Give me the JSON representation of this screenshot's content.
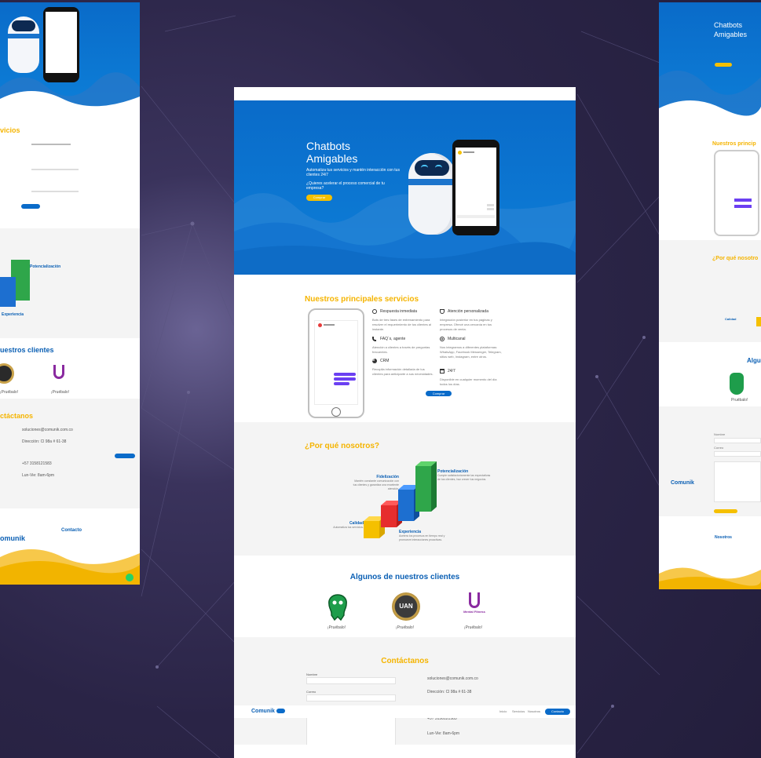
{
  "hero": {
    "title_line1": "Chatbots",
    "title_line2": "Amigables",
    "subtitle": "Automatiza tus servicios y mantén interacción con tus clientes 24/7",
    "question": "¿Quieres acelerar el proceso comercial de tu empresa?",
    "cta": "Comprar"
  },
  "services": {
    "title": "Nuestros principales servicios",
    "items": [
      {
        "title": "Respuesta inmediata",
        "desc": "Bots de tres fases de entrenamiento para resolver el requerimiento de tus clientes al instante."
      },
      {
        "title": "Atención personalizada",
        "desc": "Integración posterior en tus páginas y empresa. Ofrecé una cercanía en tus procesos de venta."
      },
      {
        "title": "FAQ´s, agente",
        "desc": "Atención a clientes a través de preguntas frecuentes."
      },
      {
        "title": "Multicanal",
        "desc": "Nos integramos a diferentes plataformas: WhatsApp, Facebook Messenger, Telegram, sitios web, Instagram, entre otros."
      },
      {
        "title": "CRM",
        "desc": "Recopila información detallada de tus clientes para anticiparte a sus necesidades."
      },
      {
        "title": "24/7",
        "desc": "Disponible en cualquier momento del día todos los días."
      }
    ],
    "cta": "Comprar"
  },
  "why": {
    "title": "¿Por qué nosotros?",
    "labels": [
      {
        "title": "Potencialización",
        "desc": "Cumple satisfactoriamente las expectativas de tus clientes, haz crecer tus negocios."
      },
      {
        "title": "Fidelización",
        "desc": "Mantén constante comunicación con tus clientes y garantiza una excelente atención."
      },
      {
        "title": "Calidad",
        "desc": "Automatiza tus servicios."
      },
      {
        "title": "Experiencia",
        "desc": "Acelera los procesos en tiempo real y promueve interacciones proactivas."
      }
    ]
  },
  "clients": {
    "title": "Algunos de nuestros clientes",
    "items": [
      {
        "label": "¡Pruébalo!"
      },
      {
        "label": "¡Pruébalo!",
        "logo_text": "UAN"
      },
      {
        "label": "¡Pruébalo!",
        "logo_text": "Mental Fitness"
      }
    ]
  },
  "contact": {
    "title": "Contáctanos",
    "name_label": "Nombre",
    "email_label": "Correo",
    "email": "soluciones@comunik.com.co",
    "address": "Dirección: Cl 98a # 61-38",
    "phone": "+57 3158121583",
    "hours": "Lun-Vie: 8am-6pm"
  },
  "navbar": {
    "logo": "Comunik",
    "links": [
      "Inicio",
      "Servicios",
      "Nosotros"
    ],
    "cta": "Contacto"
  },
  "left_mock": {
    "services_title": "vicios",
    "clients_title": "uestros clientes",
    "client_label_1": "¡Pruébalo!",
    "client_label_2": "¡Pruébalo!",
    "contact_title": "ctáctanos",
    "email": "soluciones@comunik.com.co",
    "address": "Dirección: Cl 98a # 61-38",
    "phone": "+57 3158121583",
    "hours": "Lun-Vie: 8am-6pm",
    "footer_title": "Contacto",
    "logo": "omunik",
    "why_label1": "Potencialización",
    "why_label2": "Experiencia"
  },
  "right_mock": {
    "title_line1": "Chatbots",
    "title_line2": "Amigables",
    "services_title": "Nuestros princip",
    "why_title": "¿Por qué nosotro",
    "clients_title": "Algu",
    "client_label": "Pruébalo!",
    "logo": "Comunik",
    "footer_title": "Nosotros",
    "name_label": "Nombre",
    "email_label": "Correo",
    "calidad": "Calidad"
  },
  "colors": {
    "background": "#2a2446",
    "brand_blue": "#0a6bc9",
    "accent_yellow": "#f5b400",
    "title_blue": "#0a5fb4"
  }
}
